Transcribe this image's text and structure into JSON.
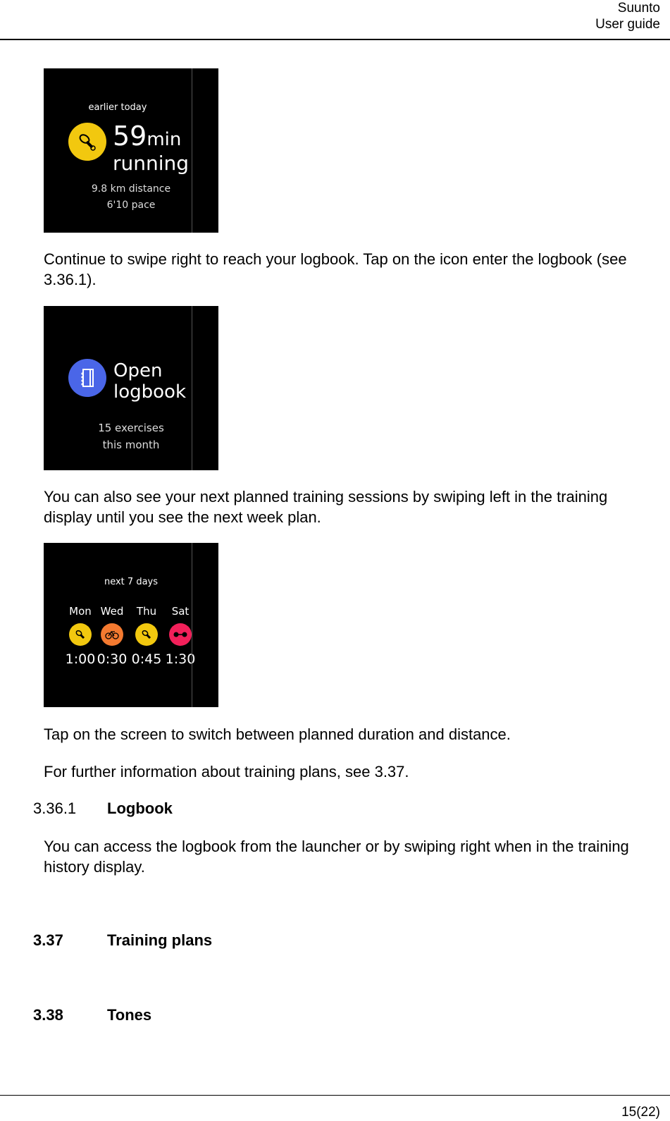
{
  "header": {
    "brand": "Suunto",
    "doc": "User guide"
  },
  "screens": {
    "history": {
      "caption": "earlier today",
      "value": "59",
      "unit": "min",
      "activity": "running",
      "line1": "9.8 km distance",
      "line2": "6'10 pace",
      "icon": "running-shoe-icon",
      "icon_color": "#f2c80f"
    },
    "logbook": {
      "title1": "Open",
      "title2": "logbook",
      "line1": "15 exercises",
      "line2": "this month",
      "icon": "logbook-icon",
      "icon_color": "#4a66e8"
    },
    "plan": {
      "caption": "next 7 days",
      "days": [
        {
          "day": "Mon",
          "time": "1:00",
          "icon": "running-shoe-icon",
          "color": "#f2c80f"
        },
        {
          "day": "Wed",
          "time": "0:30",
          "icon": "bicycle-icon",
          "color": "#f47a30"
        },
        {
          "day": "Thu",
          "time": "0:45",
          "icon": "running-shoe-icon",
          "color": "#f2c80f"
        },
        {
          "day": "Sat",
          "time": "1:30",
          "icon": "dumbbell-icon",
          "color": "#f2205a"
        }
      ]
    }
  },
  "paragraphs": {
    "p1": "Continue to swipe right to reach your logbook. Tap on the icon enter the logbook (see 3.36.1).",
    "p2": "You can also see your next planned training sessions by swiping left in the training display until you see the next week plan.",
    "p3": "Tap on the screen to switch between planned duration and distance.",
    "p4": "For further information about training plans, see 3.37.",
    "p5": "You can access the logbook from the launcher or by swiping right when in the training history display."
  },
  "sections": {
    "s3361": {
      "num": "3.36.1",
      "title": "Logbook"
    },
    "s337": {
      "num": "3.37",
      "title": "Training plans"
    },
    "s338": {
      "num": "3.38",
      "title": "Tones"
    }
  },
  "footer": {
    "page": "15(22)"
  }
}
